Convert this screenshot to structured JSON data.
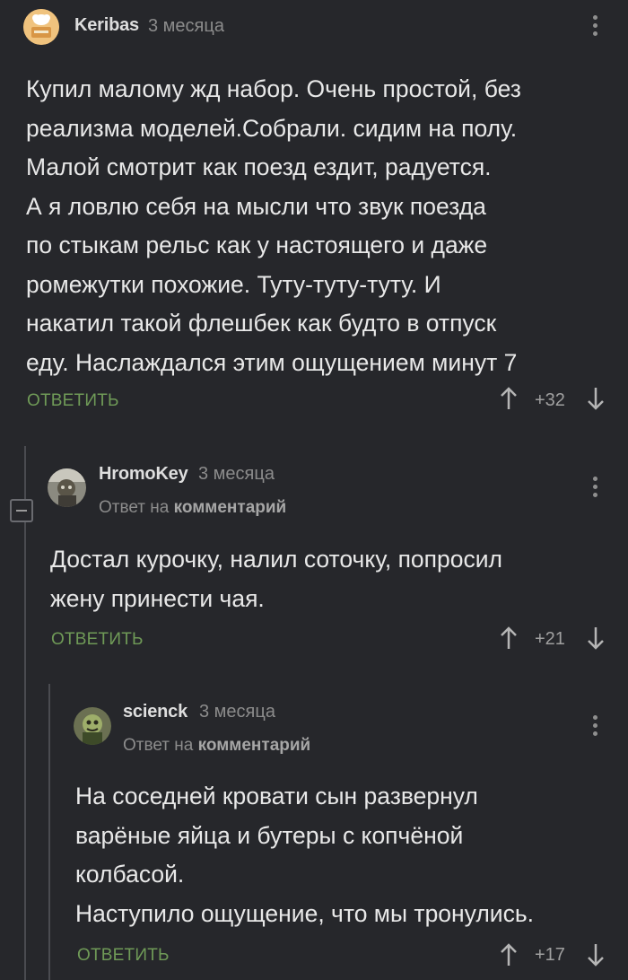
{
  "comments": [
    {
      "username": "Keribas",
      "time": "3 месяца",
      "text": "Купил малому жд набор. Очень простой, без\nреализма моделей.Собрали. сидим на полу.\nМалой смотрит как поезд ездит, радуется.\nА я ловлю себя на мысли что звук поезда\nпо стыкам рельс как у настоящего и даже\nромежутки похожие. Туту-туту-туту. И\nнакатил такой флешбек как будто в отпуск\nеду. Наслаждался этим ощущением минут 7",
      "reply_label": "ОТВЕТИТЬ",
      "rating": "+32"
    },
    {
      "username": "HromoKey",
      "time": "3 месяца",
      "reply_prefix": "Ответ на",
      "reply_target": "комментарий",
      "text": "Достал курочку, налил соточку, попросил\nжену принести чая.",
      "reply_label": "ОТВЕТИТЬ",
      "rating": "+21"
    },
    {
      "username": "scienck",
      "time": "3 месяца",
      "reply_prefix": "Ответ на",
      "reply_target": "комментарий",
      "text": "На соседней кровати сын развернул\nварёные яйца и бутеры с копчёной\nколбасой.\nНаступило ощущение, что мы тронулись.",
      "reply_label": "ОТВЕТИТЬ",
      "rating": "+17"
    }
  ],
  "colors": {
    "background": "#26272b",
    "reply_green": "#6f9a57",
    "thread_line": "#4a4b50"
  },
  "icons": {
    "more": "kebab-menu-icon",
    "upvote": "arrow-up-icon",
    "downvote": "arrow-down-icon",
    "collapse": "minus-collapse-icon"
  }
}
